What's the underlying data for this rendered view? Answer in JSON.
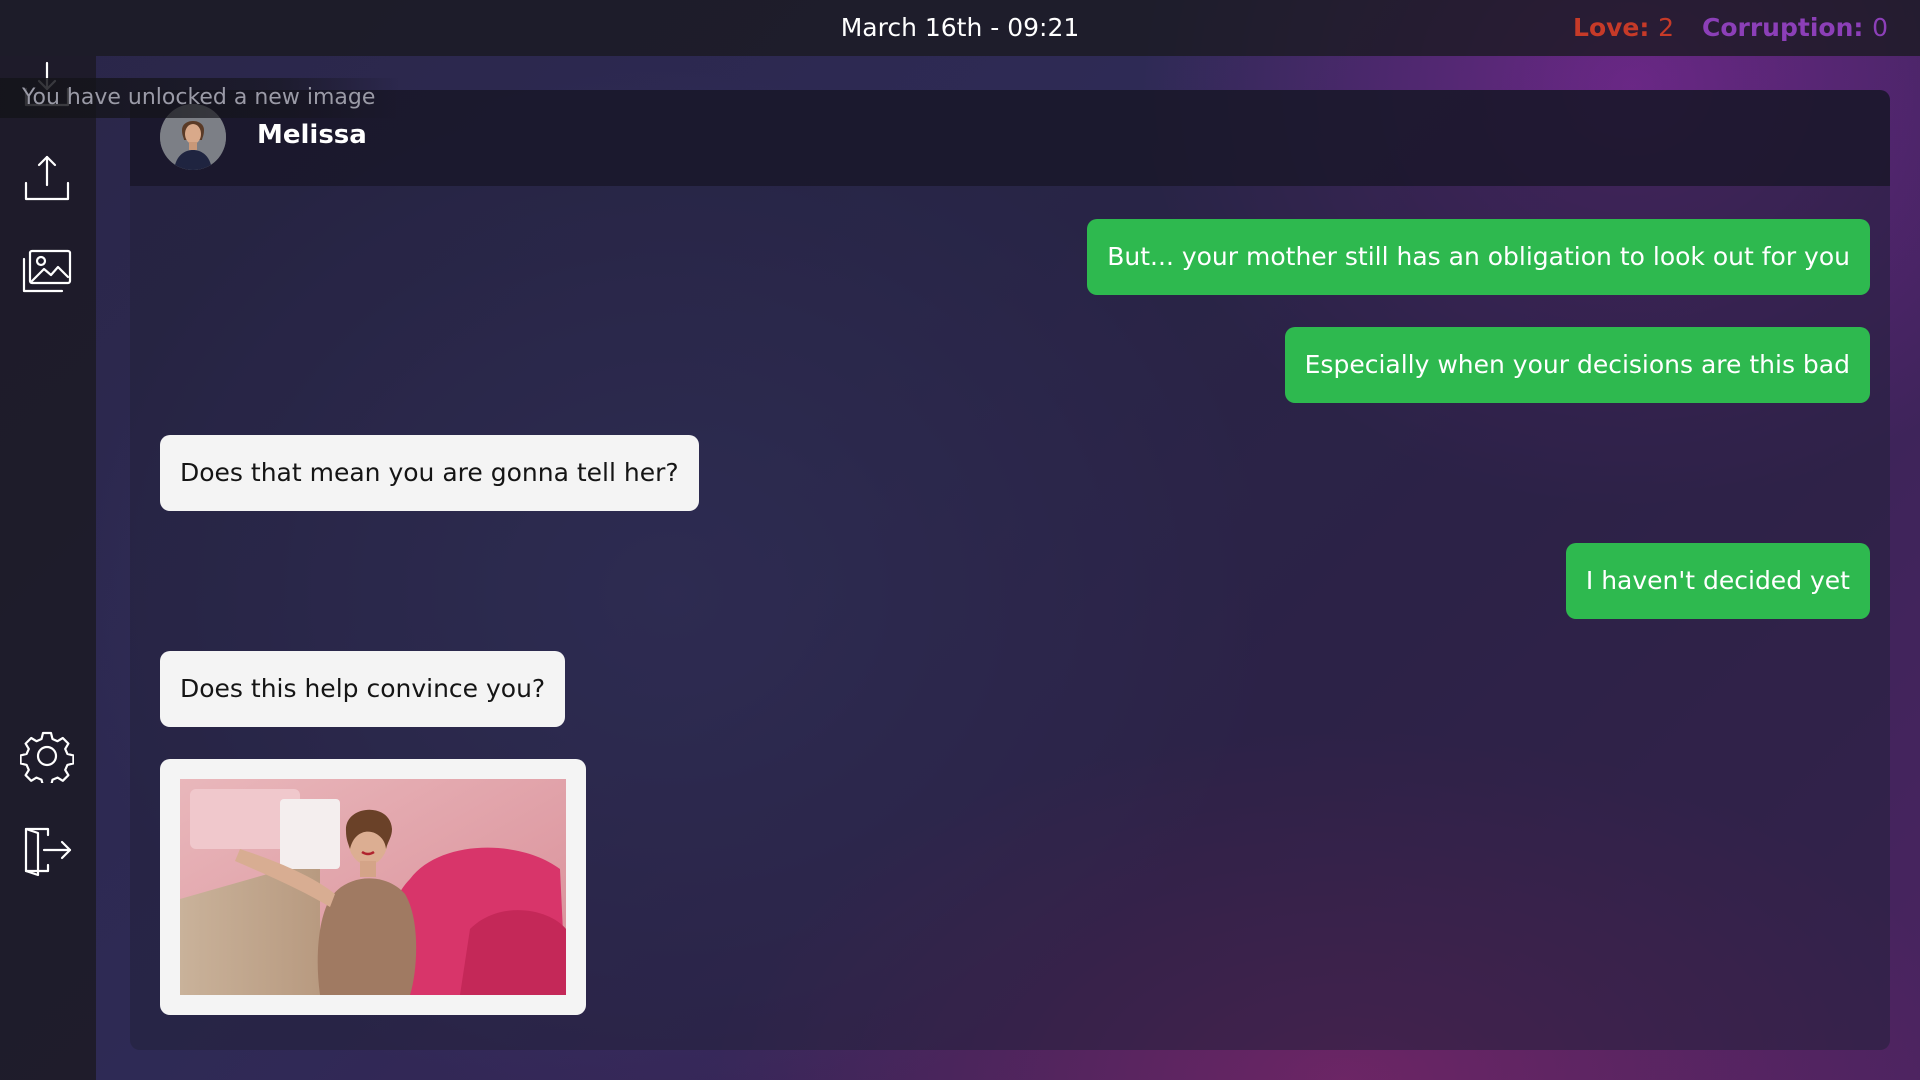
{
  "topbar": {
    "date_time": "March 16th - 09:21",
    "love_label": "Love:",
    "love_value": "2",
    "corruption_label": "Corruption:",
    "corruption_value": "0"
  },
  "notification": {
    "text": "You have unlocked a new image"
  },
  "sidebar": {
    "items": [
      {
        "icon": "download-icon"
      },
      {
        "icon": "upload-icon"
      },
      {
        "icon": "gallery-icon"
      },
      {
        "icon": "gear-icon"
      },
      {
        "icon": "exit-icon"
      }
    ]
  },
  "chat": {
    "contact_name": "Melissa",
    "messages": [
      {
        "from": "player",
        "text": "But... your mother still has an obligation to look out for you"
      },
      {
        "from": "player",
        "text": "Especially when your decisions are this bad"
      },
      {
        "from": "contact",
        "text": "Does that mean you are gonna tell her?"
      },
      {
        "from": "player",
        "text": "I haven't decided yet"
      },
      {
        "from": "contact",
        "text": "Does this help convince you?"
      },
      {
        "from": "contact",
        "type": "image"
      }
    ]
  },
  "colors": {
    "player_bubble": "#2eb94f",
    "contact_bubble": "#f4f4f4",
    "love": "#c63a28",
    "corruption": "#8c3fb8"
  }
}
